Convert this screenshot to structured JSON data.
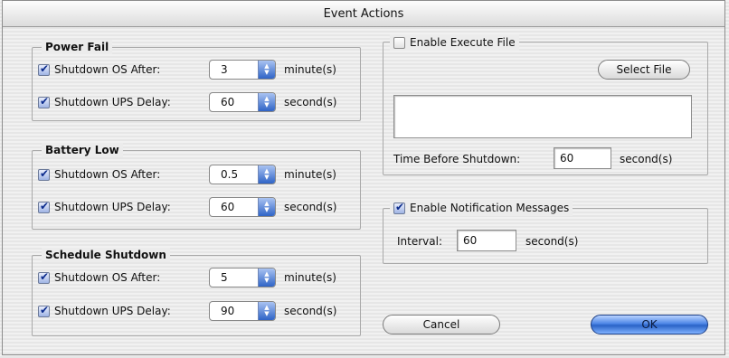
{
  "window": {
    "title": "Event Actions"
  },
  "power_fail": {
    "title": "Power Fail",
    "os_label": "Shutdown OS After:",
    "os_value": "3",
    "os_unit": "minute(s)",
    "ups_label": "Shutdown UPS Delay:",
    "ups_value": "60",
    "ups_unit": "second(s)"
  },
  "battery_low": {
    "title": "Battery Low",
    "os_label": "Shutdown OS After:",
    "os_value": "0.5",
    "os_unit": "minute(s)",
    "ups_label": "Shutdown UPS Delay:",
    "ups_value": "60",
    "ups_unit": "second(s)"
  },
  "schedule_shutdown": {
    "title": "Schedule Shutdown",
    "os_label": "Shutdown OS After:",
    "os_value": "5",
    "os_unit": "minute(s)",
    "ups_label": "Shutdown UPS Delay:",
    "ups_value": "90",
    "ups_unit": "second(s)"
  },
  "execute_file": {
    "label": "Enable Execute File",
    "select_button": "Select File",
    "path_value": "",
    "time_label": "Time Before Shutdown:",
    "time_value": "60",
    "time_unit": "second(s)"
  },
  "notification": {
    "label": "Enable Notification Messages",
    "interval_label": "Interval:",
    "interval_value": "60",
    "interval_unit": "second(s)"
  },
  "buttons": {
    "cancel": "Cancel",
    "ok": "OK"
  }
}
